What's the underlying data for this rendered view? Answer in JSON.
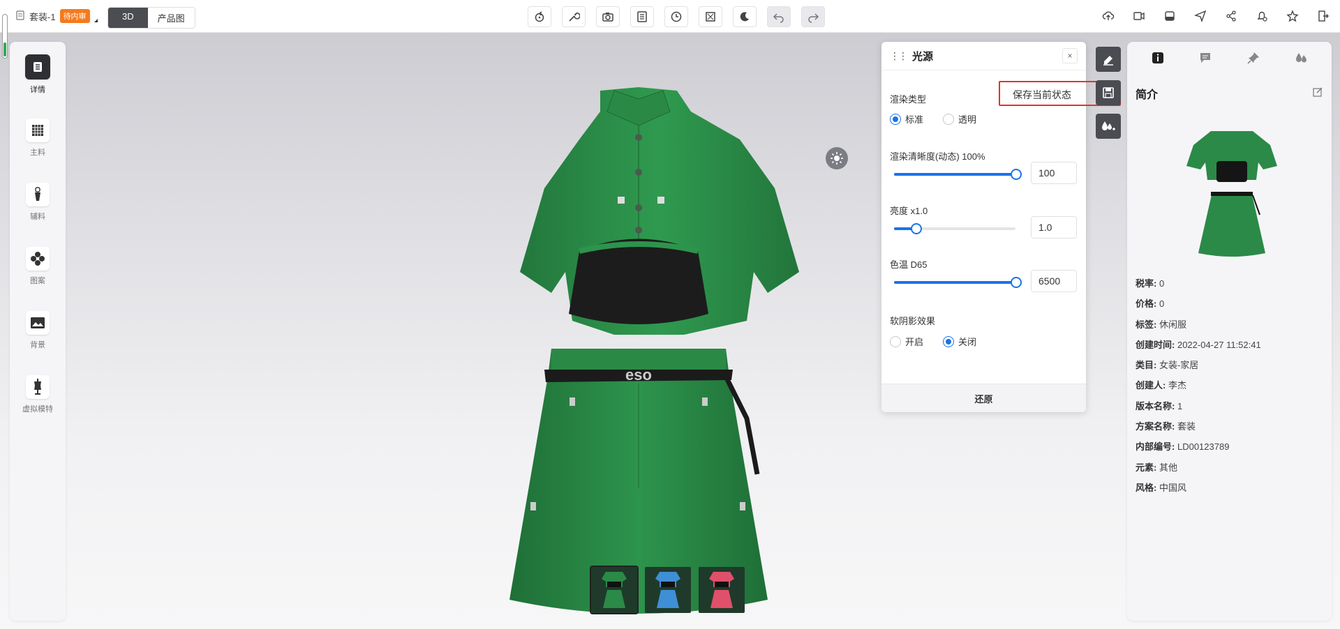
{
  "header": {
    "doc_name": "套装-1",
    "status_badge": "待内审",
    "view_modes": [
      "3D",
      "产品图"
    ],
    "active_view": "3D",
    "toolbar_icons": [
      "rotate-icon",
      "wrench-icon",
      "camera-icon",
      "document-icon",
      "clock-icon",
      "fullscreen-icon",
      "moon-icon",
      "undo-icon",
      "redo-icon"
    ],
    "right_icons": [
      "cloud-upload-icon",
      "video-icon",
      "stack-icon",
      "send-icon",
      "share-icon",
      "bell-off-icon",
      "star-icon",
      "exit-icon"
    ]
  },
  "sidebar": {
    "items": [
      {
        "label": "详情",
        "icon": "document-icon",
        "active": true
      },
      {
        "label": "主料",
        "icon": "fabric-grid-icon"
      },
      {
        "label": "辅料",
        "icon": "zipper-icon"
      },
      {
        "label": "图案",
        "icon": "pattern-icon"
      },
      {
        "label": "背景",
        "icon": "image-icon"
      },
      {
        "label": "虚拟模特",
        "icon": "mannequin-icon"
      }
    ]
  },
  "light_panel": {
    "title": "光源",
    "render_type_label": "渲染类型",
    "render_options": [
      "标准",
      "透明"
    ],
    "render_selected": "标准",
    "clarity_label": "渲染清晰度(动态) 100%",
    "clarity_value": "100",
    "clarity_fraction": 1.0,
    "brightness_label": "亮度 x1.0",
    "brightness_value": "1.0",
    "brightness_fraction": 0.18,
    "color_temp_label": "色温 D65",
    "color_temp_value": "6500",
    "color_temp_fraction": 1.0,
    "soft_shadow_label": "软阴影效果",
    "shadow_options": [
      "开启",
      "关闭"
    ],
    "shadow_selected": "关闭",
    "reset_label": "还原",
    "save_tooltip": "保存当前状态"
  },
  "colors": {
    "accent": "#1a73e8",
    "garment_green": "#2b8a47",
    "badge_orange": "#f57a1d",
    "highlight_red": "#e4312b"
  },
  "variants": [
    "green",
    "blue",
    "red"
  ],
  "info_panel": {
    "title": "简介",
    "fields": [
      {
        "label": "税率:",
        "value": "0"
      },
      {
        "label": "价格:",
        "value": "0"
      },
      {
        "label": "标签:",
        "value": "休闲服"
      },
      {
        "label": "创建时间:",
        "value": "2022-04-27 11:52:41"
      },
      {
        "label": "类目:",
        "value": "女装-家居"
      },
      {
        "label": "创建人:",
        "value": "李杰"
      },
      {
        "label": "版本名称:",
        "value": "1"
      },
      {
        "label": "方案名称:",
        "value": "套装"
      },
      {
        "label": "内部编号:",
        "value": "LD00123789"
      },
      {
        "label": "元素:",
        "value": "其他"
      },
      {
        "label": "风格:",
        "value": "中国风"
      }
    ]
  }
}
